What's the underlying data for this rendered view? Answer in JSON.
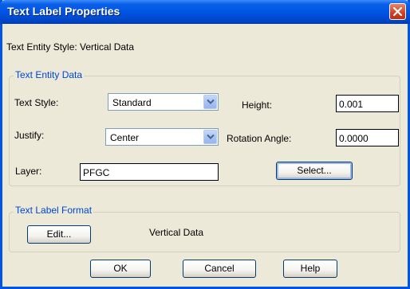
{
  "window": {
    "title": "Text Label Properties"
  },
  "style_line": "Text Entity Style: Vertical Data",
  "entity_group": {
    "legend": "Text Entity Data",
    "text_style_label": "Text Style:",
    "text_style_value": "Standard",
    "height_label": "Height:",
    "height_value": "0.001",
    "justify_label": "Justify:",
    "justify_value": "Center",
    "rotation_label": "Rotation Angle:",
    "rotation_value": "0.0000",
    "layer_label": "Layer:",
    "layer_value": "PFGC",
    "select_button": "Select..."
  },
  "format_group": {
    "legend": "Text Label Format",
    "edit_button": "Edit...",
    "format_value": "Vertical Data"
  },
  "buttons": {
    "ok": "OK",
    "cancel": "Cancel",
    "help": "Help"
  },
  "icons": {
    "close": "close-icon",
    "dropdown": "chevron-down-icon"
  }
}
